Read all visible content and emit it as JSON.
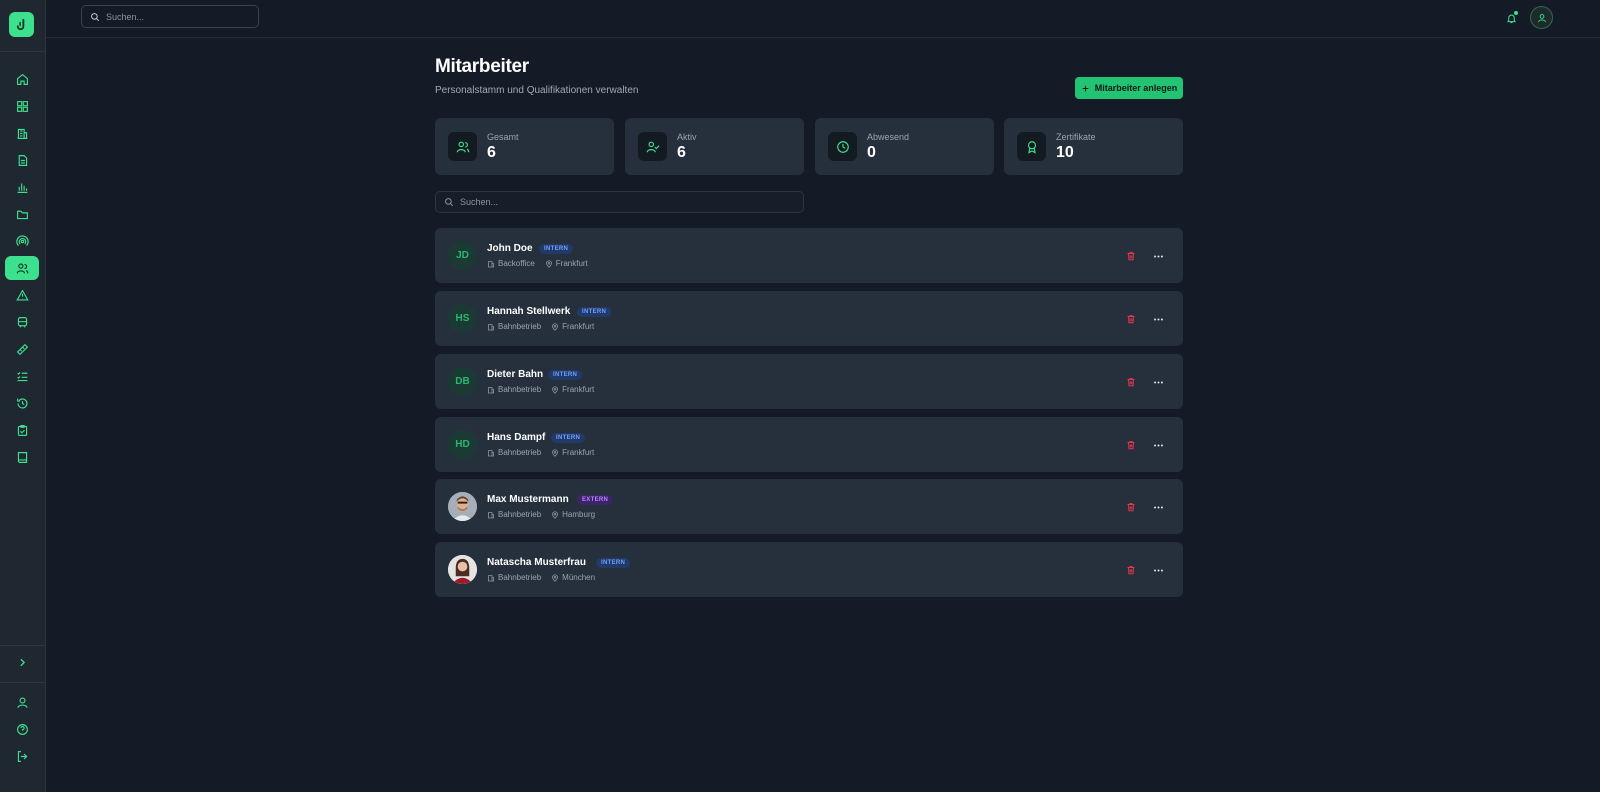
{
  "header": {
    "search_placeholder": "Suchen..."
  },
  "page": {
    "title": "Mitarbeiter",
    "subtitle": "Personalstamm und Qualifikationen verwalten",
    "add_button_label": "Mitarbeiter anlegen"
  },
  "stats": [
    {
      "label": "Gesamt",
      "value": "6",
      "icon": "users-icon"
    },
    {
      "label": "Aktiv",
      "value": "6",
      "icon": "user-check-icon"
    },
    {
      "label": "Abwesend",
      "value": "0",
      "icon": "clock-icon"
    },
    {
      "label": "Zertifikate",
      "value": "10",
      "icon": "award-icon"
    }
  ],
  "list": {
    "search_placeholder": "Suchen..."
  },
  "employees": [
    {
      "initials": "JD",
      "name": "John Doe",
      "badge": "INTERN",
      "department": "Backoffice",
      "location": "Frankfurt"
    },
    {
      "initials": "HS",
      "name": "Hannah Stellwerk",
      "badge": "INTERN",
      "department": "Bahnbetrieb",
      "location": "Frankfurt"
    },
    {
      "initials": "DB",
      "name": "Dieter Bahn",
      "badge": "INTERN",
      "department": "Bahnbetrieb",
      "location": "Frankfurt"
    },
    {
      "initials": "HD",
      "name": "Hans Dampf",
      "badge": "INTERN",
      "department": "Bahnbetrieb",
      "location": "Frankfurt"
    },
    {
      "initials": "",
      "name": "Max Mustermann",
      "badge": "EXTERN",
      "department": "Bahnbetrieb",
      "location": "Hamburg"
    },
    {
      "initials": "",
      "name": "Natascha Musterfrau",
      "badge": "INTERN",
      "department": "Bahnbetrieb",
      "location": "München"
    }
  ],
  "colors": {
    "accent": "#3de08d",
    "background": "#151b26",
    "card": "#26303d",
    "danger": "#e5354f",
    "intern_badge": "#6fa0ff",
    "extern_badge": "#b583ff"
  }
}
